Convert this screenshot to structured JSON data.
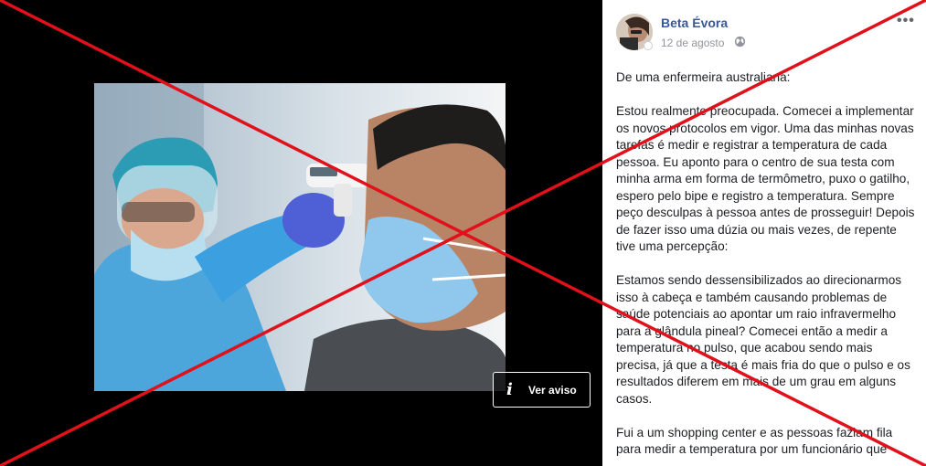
{
  "post": {
    "author": "Beta Évora",
    "date": "12 de agosto",
    "privacy_icon": "globe-icon",
    "more_label": "•••",
    "warning_button": {
      "icon": "info-icon",
      "icon_glyph": "i",
      "label": "Ver aviso"
    },
    "paragraphs": [
      "De uma enfermeira australiana:",
      "Estou realmente preocupada. Comecei a implementar os novos protocolos em vigor. Uma das minhas novas tarefas é medir e registrar a temperatura de cada pessoa. Eu aponto para o centro de sua testa com minha arma em forma de termômetro, puxo o gatilho, espero pelo bipe e registro a temperatura. Sempre peço desculpas à pessoa antes de prosseguir! Depois de fazer isso uma dúzia ou mais vezes, de repente tive uma percepção:",
      "Estamos sendo dessensibilizados ao direcionarmos isso à cabeça e também causando problemas de saúde potenciais ao apontar um raio infravermelho para a glândula pineal? Comecei então a medir a temperatura no pulso, que acabou sendo mais precisa, já que a testa é mais fria do que o pulso e os resultados diferem em mais de um grau em alguns casos.",
      "Fui a um shopping center e as pessoas faziam fila para medir a temperatura por um funcionário que"
    ]
  },
  "colors": {
    "author": "#385898",
    "cross": "#e0111b",
    "text": "#1c1e21",
    "meta": "#90949c"
  }
}
